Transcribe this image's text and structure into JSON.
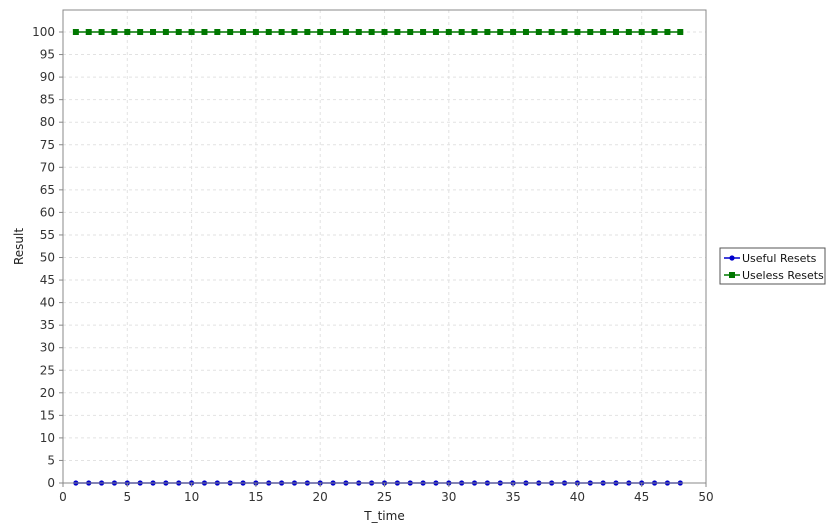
{
  "chart_data": {
    "type": "line",
    "title": "",
    "xlabel": "T_time",
    "ylabel": "Result",
    "xlim": [
      0,
      50
    ],
    "ylim": [
      0,
      100
    ],
    "x_ticks": [
      0,
      5,
      10,
      15,
      20,
      25,
      30,
      35,
      40,
      45,
      50
    ],
    "y_ticks": [
      0,
      5,
      10,
      15,
      20,
      25,
      30,
      35,
      40,
      45,
      50,
      55,
      60,
      65,
      70,
      75,
      80,
      85,
      90,
      95,
      100
    ],
    "grid": true,
    "legend_position": "right",
    "x": [
      1,
      2,
      3,
      4,
      5,
      6,
      7,
      8,
      9,
      10,
      11,
      12,
      13,
      14,
      15,
      16,
      17,
      18,
      19,
      20,
      21,
      22,
      23,
      24,
      25,
      26,
      27,
      28,
      29,
      30,
      31,
      32,
      33,
      34,
      35,
      36,
      37,
      38,
      39,
      40,
      41,
      42,
      43,
      44,
      45,
      46,
      47,
      48
    ],
    "series": [
      {
        "name": "Useful Resets",
        "color": "#0000cc",
        "marker": "circle",
        "values": [
          0,
          0,
          0,
          0,
          0,
          0,
          0,
          0,
          0,
          0,
          0,
          0,
          0,
          0,
          0,
          0,
          0,
          0,
          0,
          0,
          0,
          0,
          0,
          0,
          0,
          0,
          0,
          0,
          0,
          0,
          0,
          0,
          0,
          0,
          0,
          0,
          0,
          0,
          0,
          0,
          0,
          0,
          0,
          0,
          0,
          0,
          0,
          0
        ]
      },
      {
        "name": "Useless Resets",
        "color": "#007700",
        "marker": "square",
        "values": [
          100,
          100,
          100,
          100,
          100,
          100,
          100,
          100,
          100,
          100,
          100,
          100,
          100,
          100,
          100,
          100,
          100,
          100,
          100,
          100,
          100,
          100,
          100,
          100,
          100,
          100,
          100,
          100,
          100,
          100,
          100,
          100,
          100,
          100,
          100,
          100,
          100,
          100,
          100,
          100,
          100,
          100,
          100,
          100,
          100,
          100,
          100,
          100
        ]
      }
    ]
  }
}
